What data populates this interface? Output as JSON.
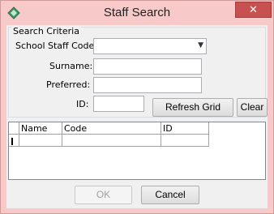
{
  "window": {
    "title": "Staff Search",
    "close_glyph": "✕",
    "app_icon": "green-diamond-app-icon"
  },
  "search_criteria": {
    "legend": "Search Criteria",
    "fields": {
      "staff_code": {
        "label": "School Staff Code:",
        "value": ""
      },
      "surname": {
        "label": "Surname:",
        "value": ""
      },
      "preferred": {
        "label": "Preferred:",
        "value": ""
      },
      "id": {
        "label": "ID:",
        "value": ""
      }
    },
    "refresh_label": "Refresh Grid",
    "clear_label": "Clear"
  },
  "results_grid": {
    "columns": [
      "Name",
      "Code",
      "ID"
    ],
    "rows": [
      [
        "",
        "",
        ""
      ]
    ]
  },
  "footer": {
    "ok_label": "OK",
    "cancel_label": "Cancel",
    "ok_enabled": false
  },
  "colors": {
    "frame": "#f7c9c9",
    "close_button": "#c75050",
    "client_background": "#f0f0f0"
  }
}
